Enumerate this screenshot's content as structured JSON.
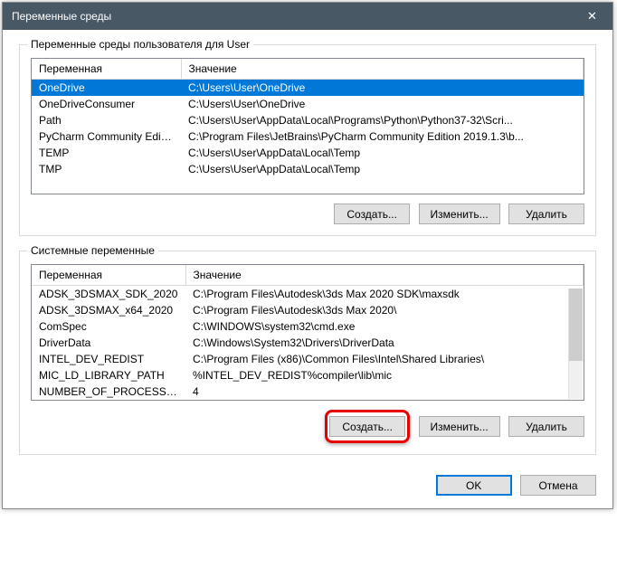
{
  "window": {
    "title": "Переменные среды"
  },
  "user_section": {
    "label": "Переменные среды пользователя для User",
    "columns": {
      "name": "Переменная",
      "value": "Значение"
    },
    "rows": [
      {
        "name": "OneDrive",
        "value": "C:\\Users\\User\\OneDrive",
        "selected": true
      },
      {
        "name": "OneDriveConsumer",
        "value": "C:\\Users\\User\\OneDrive"
      },
      {
        "name": "Path",
        "value": "C:\\Users\\User\\AppData\\Local\\Programs\\Python\\Python37-32\\Scri..."
      },
      {
        "name": "PyCharm Community Edition",
        "value": "C:\\Program Files\\JetBrains\\PyCharm Community Edition 2019.1.3\\b..."
      },
      {
        "name": "TEMP",
        "value": "C:\\Users\\User\\AppData\\Local\\Temp"
      },
      {
        "name": "TMP",
        "value": "C:\\Users\\User\\AppData\\Local\\Temp"
      }
    ],
    "buttons": {
      "create": "Создать...",
      "edit": "Изменить...",
      "delete": "Удалить"
    }
  },
  "system_section": {
    "label": "Системные переменные",
    "columns": {
      "name": "Переменная",
      "value": "Значение"
    },
    "rows": [
      {
        "name": "ADSK_3DSMAX_SDK_2020",
        "value": "C:\\Program Files\\Autodesk\\3ds Max 2020 SDK\\maxsdk"
      },
      {
        "name": "ADSK_3DSMAX_x64_2020",
        "value": "C:\\Program Files\\Autodesk\\3ds Max 2020\\"
      },
      {
        "name": "ComSpec",
        "value": "C:\\WINDOWS\\system32\\cmd.exe"
      },
      {
        "name": "DriverData",
        "value": "C:\\Windows\\System32\\Drivers\\DriverData"
      },
      {
        "name": "INTEL_DEV_REDIST",
        "value": "C:\\Program Files (x86)\\Common Files\\Intel\\Shared Libraries\\"
      },
      {
        "name": "MIC_LD_LIBRARY_PATH",
        "value": "%INTEL_DEV_REDIST%compiler\\lib\\mic"
      },
      {
        "name": "NUMBER_OF_PROCESSORS",
        "value": "4"
      }
    ],
    "buttons": {
      "create": "Создать...",
      "edit": "Изменить...",
      "delete": "Удалить"
    }
  },
  "footer": {
    "ok": "OK",
    "cancel": "Отмена"
  }
}
